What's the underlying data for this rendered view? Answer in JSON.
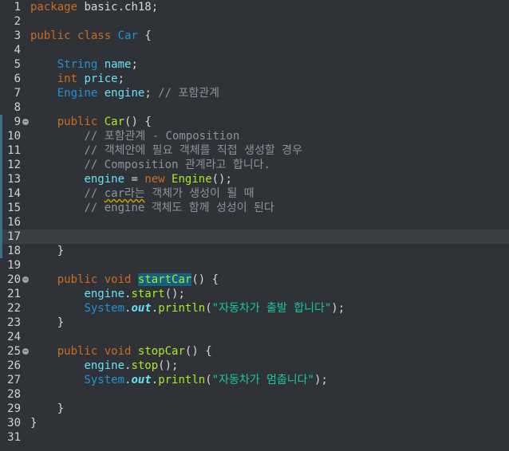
{
  "editor": {
    "lines": [
      {
        "n": "1",
        "segs": [
          [
            "kw",
            "package"
          ],
          [
            "pl",
            " basic.ch18;"
          ]
        ]
      },
      {
        "n": "2",
        "segs": []
      },
      {
        "n": "3",
        "segs": [
          [
            "kw",
            "public"
          ],
          [
            "pl",
            " "
          ],
          [
            "kw",
            "class"
          ],
          [
            "pl",
            " "
          ],
          [
            "ty",
            "Car"
          ],
          [
            "pl",
            " {"
          ]
        ]
      },
      {
        "n": "4",
        "segs": []
      },
      {
        "n": "5",
        "segs": [
          [
            "pl",
            "    "
          ],
          [
            "ty",
            "String"
          ],
          [
            "pl",
            " "
          ],
          [
            "fd",
            "name"
          ],
          [
            "pl",
            ";"
          ]
        ]
      },
      {
        "n": "6",
        "segs": [
          [
            "pl",
            "    "
          ],
          [
            "kw",
            "int"
          ],
          [
            "pl",
            " "
          ],
          [
            "fd",
            "price"
          ],
          [
            "pl",
            ";"
          ]
        ]
      },
      {
        "n": "7",
        "segs": [
          [
            "pl",
            "    "
          ],
          [
            "ty",
            "Engine"
          ],
          [
            "pl",
            " "
          ],
          [
            "fd",
            "engine"
          ],
          [
            "pl",
            "; "
          ],
          [
            "cm",
            "// 포함관계"
          ]
        ]
      },
      {
        "n": "8",
        "segs": []
      },
      {
        "n": "9",
        "fold": true,
        "mark": true,
        "segs": [
          [
            "pl",
            "    "
          ],
          [
            "kw",
            "public"
          ],
          [
            "pl",
            " "
          ],
          [
            "me",
            "Car"
          ],
          [
            "pl",
            "() {"
          ]
        ]
      },
      {
        "n": "10",
        "mark": true,
        "segs": [
          [
            "pl",
            "        "
          ],
          [
            "cm",
            "// 포함관계 - Composition"
          ]
        ]
      },
      {
        "n": "11",
        "mark": true,
        "segs": [
          [
            "pl",
            "        "
          ],
          [
            "cm",
            "// 객체안에 필요 객체를 직접 생성할 경우"
          ]
        ]
      },
      {
        "n": "12",
        "mark": true,
        "segs": [
          [
            "pl",
            "        "
          ],
          [
            "cm",
            "// Composition 관계라고 합니다."
          ]
        ]
      },
      {
        "n": "13",
        "mark": true,
        "segs": [
          [
            "pl",
            "        "
          ],
          [
            "fd",
            "engine"
          ],
          [
            "pl",
            " = "
          ],
          [
            "kw",
            "new"
          ],
          [
            "pl",
            " "
          ],
          [
            "me",
            "Engine"
          ],
          [
            "pl",
            "();"
          ]
        ]
      },
      {
        "n": "14",
        "mark": true,
        "segs": [
          [
            "pl",
            "        "
          ],
          [
            "cm",
            "// "
          ],
          [
            "cmsq",
            "car라는"
          ],
          [
            "cm",
            " 객체가 생성이 될 때"
          ]
        ]
      },
      {
        "n": "15",
        "mark": true,
        "segs": [
          [
            "pl",
            "        "
          ],
          [
            "cm",
            "// engine 객체도 함께 성성이 된다"
          ]
        ]
      },
      {
        "n": "16",
        "mark": true,
        "segs": []
      },
      {
        "n": "17",
        "mark": true,
        "current": true,
        "segs": []
      },
      {
        "n": "18",
        "mark": true,
        "segs": [
          [
            "pl",
            "    }"
          ]
        ]
      },
      {
        "n": "19",
        "segs": []
      },
      {
        "n": "20",
        "fold": true,
        "segs": [
          [
            "pl",
            "    "
          ],
          [
            "kw",
            "public"
          ],
          [
            "pl",
            " "
          ],
          [
            "kw",
            "void"
          ],
          [
            "pl",
            " "
          ],
          [
            "mehl",
            "startCar"
          ],
          [
            "pl",
            "() {"
          ]
        ]
      },
      {
        "n": "21",
        "segs": [
          [
            "pl",
            "        "
          ],
          [
            "fd",
            "engine"
          ],
          [
            "pl",
            "."
          ],
          [
            "me",
            "start"
          ],
          [
            "pl",
            "();"
          ]
        ]
      },
      {
        "n": "22",
        "segs": [
          [
            "pl",
            "        "
          ],
          [
            "ty",
            "System"
          ],
          [
            "pl",
            "."
          ],
          [
            "so",
            "out"
          ],
          [
            "pl",
            "."
          ],
          [
            "me",
            "println"
          ],
          [
            "pl",
            "("
          ],
          [
            "st",
            "\"자동차가 출발 합니다\""
          ],
          [
            "pl",
            ");"
          ]
        ]
      },
      {
        "n": "23",
        "segs": [
          [
            "pl",
            "    }"
          ]
        ]
      },
      {
        "n": "24",
        "segs": []
      },
      {
        "n": "25",
        "fold": true,
        "segs": [
          [
            "pl",
            "    "
          ],
          [
            "kw",
            "public"
          ],
          [
            "pl",
            " "
          ],
          [
            "kw",
            "void"
          ],
          [
            "pl",
            " "
          ],
          [
            "me",
            "stopCar"
          ],
          [
            "pl",
            "() {"
          ]
        ]
      },
      {
        "n": "26",
        "segs": [
          [
            "pl",
            "        "
          ],
          [
            "fd",
            "engine"
          ],
          [
            "pl",
            "."
          ],
          [
            "me",
            "stop"
          ],
          [
            "pl",
            "();"
          ]
        ]
      },
      {
        "n": "27",
        "segs": [
          [
            "pl",
            "        "
          ],
          [
            "ty",
            "System"
          ],
          [
            "pl",
            "."
          ],
          [
            "so",
            "out"
          ],
          [
            "pl",
            "."
          ],
          [
            "me",
            "println"
          ],
          [
            "pl",
            "("
          ],
          [
            "st",
            "\"자동차가 멈춥니다\""
          ],
          [
            "pl",
            ");"
          ]
        ]
      },
      {
        "n": "28",
        "segs": []
      },
      {
        "n": "29",
        "segs": [
          [
            "pl",
            "    }"
          ]
        ]
      },
      {
        "n": "30",
        "segs": [
          [
            "pl",
            "}"
          ]
        ]
      },
      {
        "n": "31",
        "segs": []
      }
    ]
  }
}
